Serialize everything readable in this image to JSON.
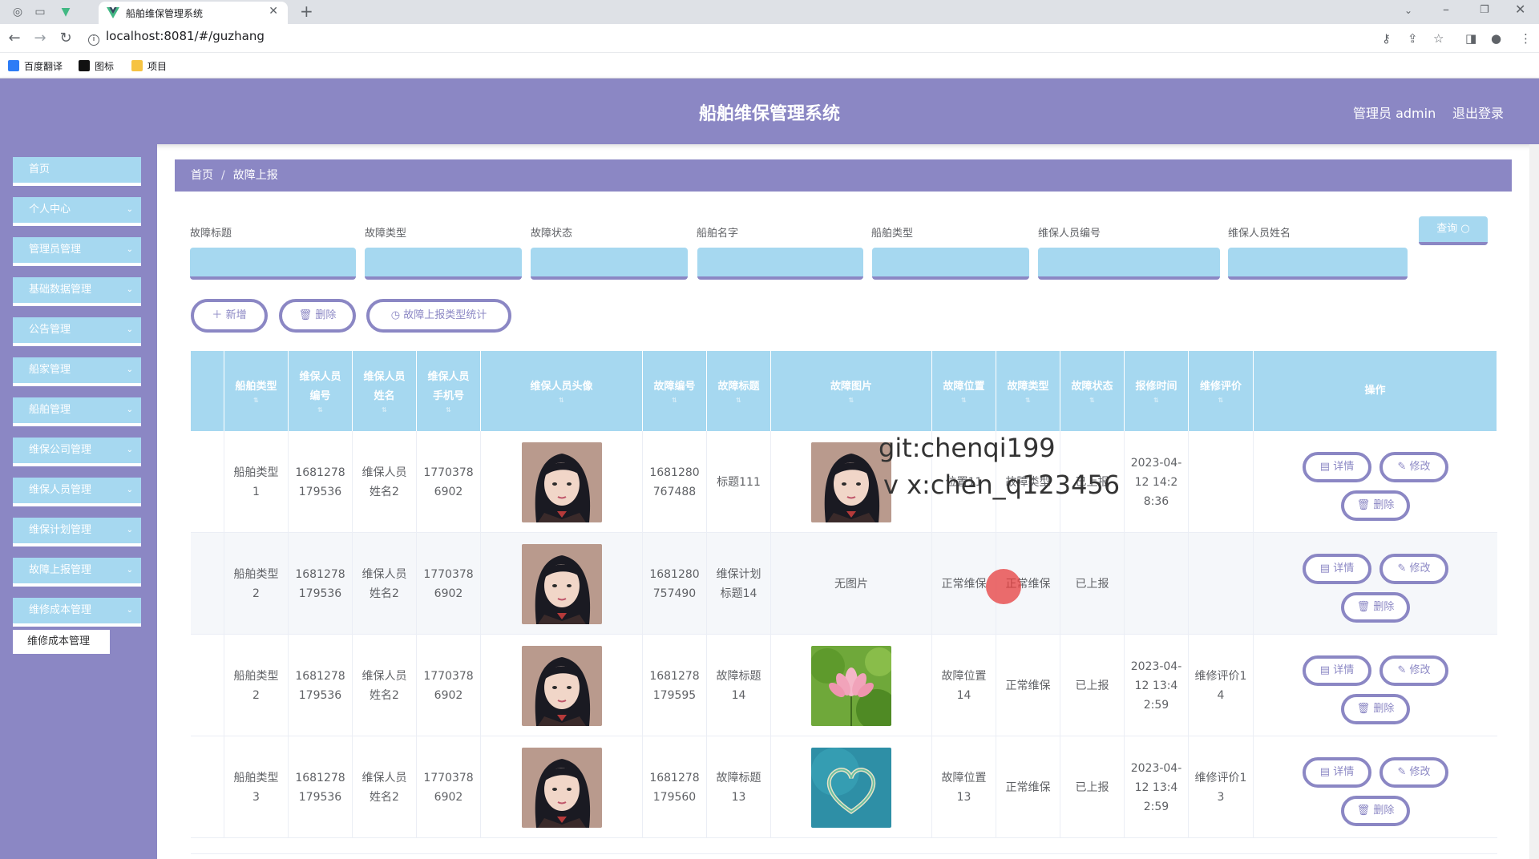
{
  "browser": {
    "tab_title": "船舶维保管理系统",
    "url": "localhost:8081/#/guzhang",
    "bookmarks": [
      {
        "label": "百度翻译",
        "icon": "baidu-translate-icon",
        "color": "#2d7cf6"
      },
      {
        "label": "图标",
        "icon": "icon-bookmark-icon",
        "color": "#111111"
      },
      {
        "label": "项目",
        "icon": "folder-icon",
        "color": "#f6c342"
      }
    ]
  },
  "header": {
    "title": "船舶维保管理系统",
    "user": "管理员 admin",
    "logout": "退出登录"
  },
  "sidebar": {
    "items": [
      {
        "label": "首页",
        "has_arrow": false
      },
      {
        "label": "个人中心",
        "has_arrow": true
      },
      {
        "label": "管理员管理",
        "has_arrow": true
      },
      {
        "label": "基础数据管理",
        "has_arrow": true
      },
      {
        "label": "公告管理",
        "has_arrow": true
      },
      {
        "label": "船家管理",
        "has_arrow": true
      },
      {
        "label": "船舶管理",
        "has_arrow": true
      },
      {
        "label": "维保公司管理",
        "has_arrow": true
      },
      {
        "label": "维保人员管理",
        "has_arrow": true
      },
      {
        "label": "维保计划管理",
        "has_arrow": true
      },
      {
        "label": "故障上报管理",
        "has_arrow": true
      },
      {
        "label": "维修成本管理",
        "has_arrow": true
      }
    ],
    "submenu": "维修成本管理"
  },
  "breadcrumb": {
    "home": "首页",
    "current": "故障上报"
  },
  "filters": {
    "labels": [
      "故障标题",
      "故障类型",
      "故障状态",
      "船舶名字",
      "船舶类型",
      "维保人员编号",
      "维保人员姓名"
    ],
    "query": "查询"
  },
  "actions": {
    "add": "新增",
    "delete": "删除",
    "stats": "故障上报类型统计"
  },
  "table": {
    "headers": [
      [
        "船舶类型"
      ],
      [
        "维保人员",
        "编号"
      ],
      [
        "维保人员",
        "姓名"
      ],
      [
        "维保人员",
        "手机号"
      ],
      [
        "维保人员头像"
      ],
      [
        "故障编号"
      ],
      [
        "故障标题"
      ],
      [
        "故障图片"
      ],
      [
        "故障位置"
      ],
      [
        "故障类型"
      ],
      [
        "故障状态"
      ],
      [
        "报修时间"
      ],
      [
        "维修评价"
      ],
      [
        "操作"
      ]
    ],
    "op_labels": {
      "detail": "详情",
      "edit": "修改",
      "delete": "删除"
    },
    "no_image": "无图片",
    "rows": [
      {
        "ship_type": "船舶类型1",
        "worker_no": "1681278179536",
        "worker_name": "维保人员姓名2",
        "phone": "17703786902",
        "fault_no": "1681280767488",
        "fault_title": "标题111",
        "image": "portrait",
        "location": "位置11",
        "fault_type": "故障类型",
        "status": "已上报",
        "time": "2023-04-12 14:28:36",
        "review": ""
      },
      {
        "ship_type": "船舶类型2",
        "worker_no": "1681278179536",
        "worker_name": "维保人员姓名2",
        "phone": "17703786902",
        "fault_no": "1681280757490",
        "fault_title": "维保计划标题14",
        "image": "none",
        "location": "正常维保",
        "fault_type": "正常维保",
        "status": "已上报",
        "time": "",
        "review": ""
      },
      {
        "ship_type": "船舶类型2",
        "worker_no": "1681278179536",
        "worker_name": "维保人员姓名2",
        "phone": "17703786902",
        "fault_no": "1681278179595",
        "fault_title": "故障标题14",
        "image": "lotus",
        "location": "故障位置14",
        "fault_type": "正常维保",
        "status": "已上报",
        "time": "2023-04-12 13:42:59",
        "review": "维修评价14"
      },
      {
        "ship_type": "船舶类型3",
        "worker_no": "1681278179536",
        "worker_name": "维保人员姓名2",
        "phone": "17703786902",
        "fault_no": "1681278179560",
        "fault_title": "故障标题13",
        "image": "heart",
        "location": "故障位置13",
        "fault_type": "正常维保",
        "status": "已上报",
        "time": "2023-04-12 13:42:59",
        "review": "维修评价13"
      }
    ]
  },
  "watermark": {
    "line1": "git:chenqi199",
    "line2": "v x:chen_q123456"
  },
  "colors": {
    "header": "#8b87c4",
    "accent": "#a6d8f0",
    "text": "#606266"
  }
}
